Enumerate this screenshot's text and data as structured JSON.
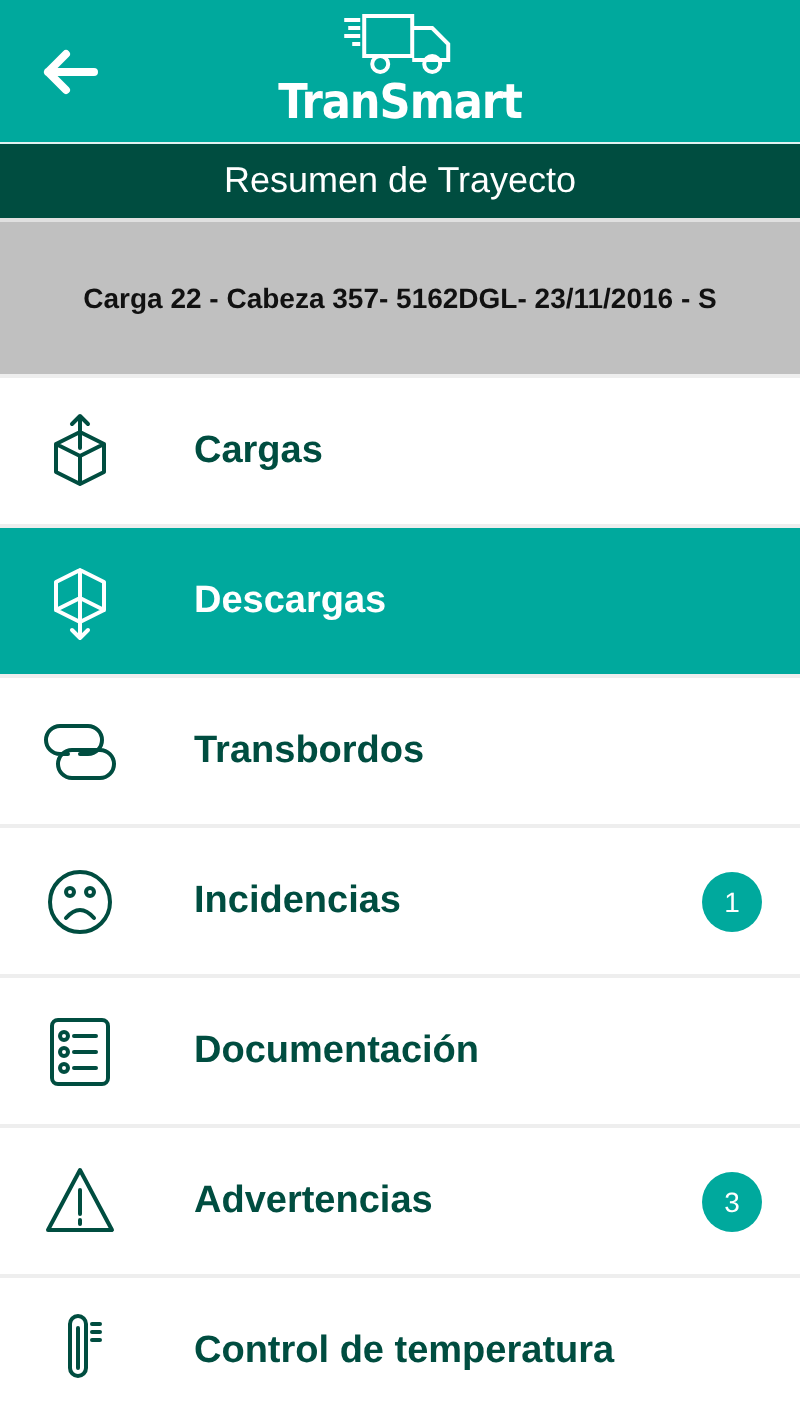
{
  "header": {
    "logo_text": "TranSmart"
  },
  "title_bar": {
    "title": "Resumen de Trayecto"
  },
  "trip_info": "Carga 22 - Cabeza 357- 5162DGL- 23/11/2016 - S",
  "menu": [
    {
      "label": "Cargas",
      "selected": false
    },
    {
      "label": "Descargas",
      "selected": true
    },
    {
      "label": "Transbordos",
      "selected": false
    },
    {
      "label": "Incidencias",
      "selected": false,
      "badge": "1"
    },
    {
      "label": "Documentación",
      "selected": false
    },
    {
      "label": "Advertencias",
      "selected": false,
      "badge": "3"
    },
    {
      "label": "Control de temperatura",
      "selected": false
    }
  ]
}
